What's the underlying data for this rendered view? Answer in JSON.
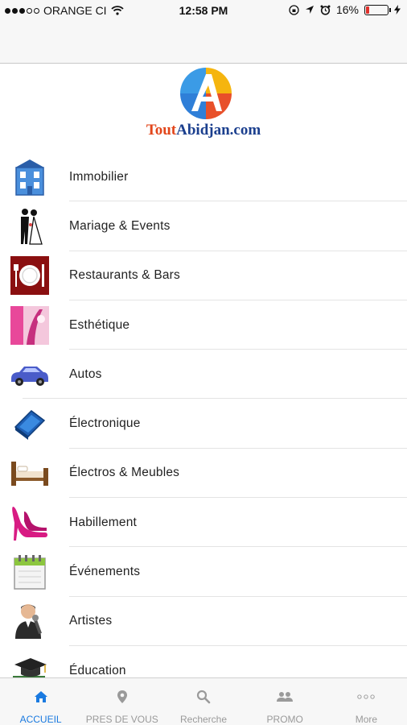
{
  "status_bar": {
    "carrier": "ORANGE CI",
    "time": "12:58 PM",
    "battery": "16%",
    "battery_level": 0.16,
    "signal_bars_filled": 3,
    "signal_bars_total": 5
  },
  "logo": {
    "tout": "Tout",
    "abidjan": "Abidjan.com",
    "colors": {
      "tout": "#e2461b",
      "abidjan": "#1b3f8e"
    }
  },
  "categories": [
    {
      "label": "Immobilier",
      "icon": "building-icon"
    },
    {
      "label": "Mariage & Events",
      "icon": "wedding-couple-icon"
    },
    {
      "label": "Restaurants & Bars",
      "icon": "plate-cutlery-icon"
    },
    {
      "label": "Esthétique",
      "icon": "beauty-icon"
    },
    {
      "label": "Autos",
      "icon": "car-icon"
    },
    {
      "label": "Électronique",
      "icon": "tablet-device-icon"
    },
    {
      "label": "Électros & Meubles",
      "icon": "bed-icon"
    },
    {
      "label": "Habillement",
      "icon": "high-heel-icon"
    },
    {
      "label": "Événements",
      "icon": "calendar-icon"
    },
    {
      "label": "Artistes",
      "icon": "singer-microphone-icon"
    },
    {
      "label": "Éducation",
      "icon": "graduation-cap-icon"
    }
  ],
  "tabs": [
    {
      "label": "ACCUEIL",
      "icon": "home-icon",
      "active": true
    },
    {
      "label": "PRES DE VOUS",
      "icon": "location-pin-icon",
      "active": false
    },
    {
      "label": "Recherche",
      "icon": "search-icon",
      "active": false
    },
    {
      "label": "PROMO",
      "icon": "people-icon",
      "active": false
    },
    {
      "label": "More",
      "icon": "more-dots-icon",
      "active": false
    }
  ],
  "colors": {
    "accent": "#1a7ae0",
    "inactive": "#9a9a9a",
    "battery_low": "#e0302a"
  }
}
